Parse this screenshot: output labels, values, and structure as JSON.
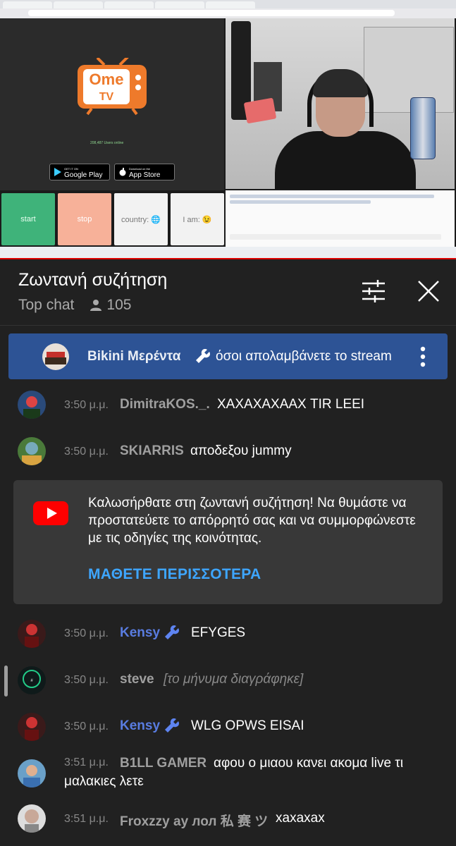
{
  "video": {
    "omegle_logo_line1": "Ome",
    "omegle_logo_line2": "TV",
    "online_text": "208,487 Users online",
    "google_play_small": "GET IT ON",
    "google_play": "Google Play",
    "app_store_small": "Download on the",
    "app_store": "App Store",
    "start_label": "start",
    "stop_label": "stop",
    "country_label": "country: 🌐",
    "iam_label": "I am: 😉",
    "colors": {
      "start": "#3fb37a",
      "stop": "#f7b199",
      "ome_orange": "#ee7a2b"
    }
  },
  "chat_header": {
    "title": "Ζωντανή συζήτηση",
    "mode": "Top chat",
    "viewer_count": "105"
  },
  "pinned": {
    "author": "Bikini Μερέντα",
    "message": "όσοι απολαμβάνετε το stream"
  },
  "messages": [
    {
      "time": "3:50 μ.μ.",
      "author": "DimitraKOS._.",
      "text": "ΧΑΧΑΧΑΧΑΑΧ TIR LEEI",
      "mod": false
    },
    {
      "time": "3:50 μ.μ.",
      "author": "SKIARRIS",
      "text": "αποδεξου jummy",
      "mod": false
    }
  ],
  "welcome": {
    "text": "Καλωσήρθατε στη ζωντανή συζήτηση! Να θυμάστε να προστατεύετε το απόρρητό σας και να συμμορφώνεστε με τις οδηγίες της κοινότητας.",
    "learn_more": "ΜΑΘΕΤΕ ΠΕΡΙΣΣΟΤΕΡΑ"
  },
  "messages2": [
    {
      "time": "3:50 μ.μ.",
      "author": "Kensy",
      "text": "EFYGES",
      "mod": true
    },
    {
      "time": "3:50 μ.μ.",
      "author": "steve",
      "text": "[το μήνυμα διαγράφηκε]",
      "deleted": true
    },
    {
      "time": "3:50 μ.μ.",
      "author": "Kensy",
      "text": "WLG OPWS EISAI",
      "mod": true
    },
    {
      "time": "3:51 μ.μ.",
      "author": "B1LL GAMER",
      "text_line1": "αφου ο μιαου κανει ακομα live τι",
      "text_line2": "μαλακιες λετε",
      "mod": false
    },
    {
      "time": "3:51 μ.μ.",
      "author": "Froxzzy ay лол 私 赛 ツ",
      "text": "xaxaxax",
      "mod": false
    }
  ]
}
